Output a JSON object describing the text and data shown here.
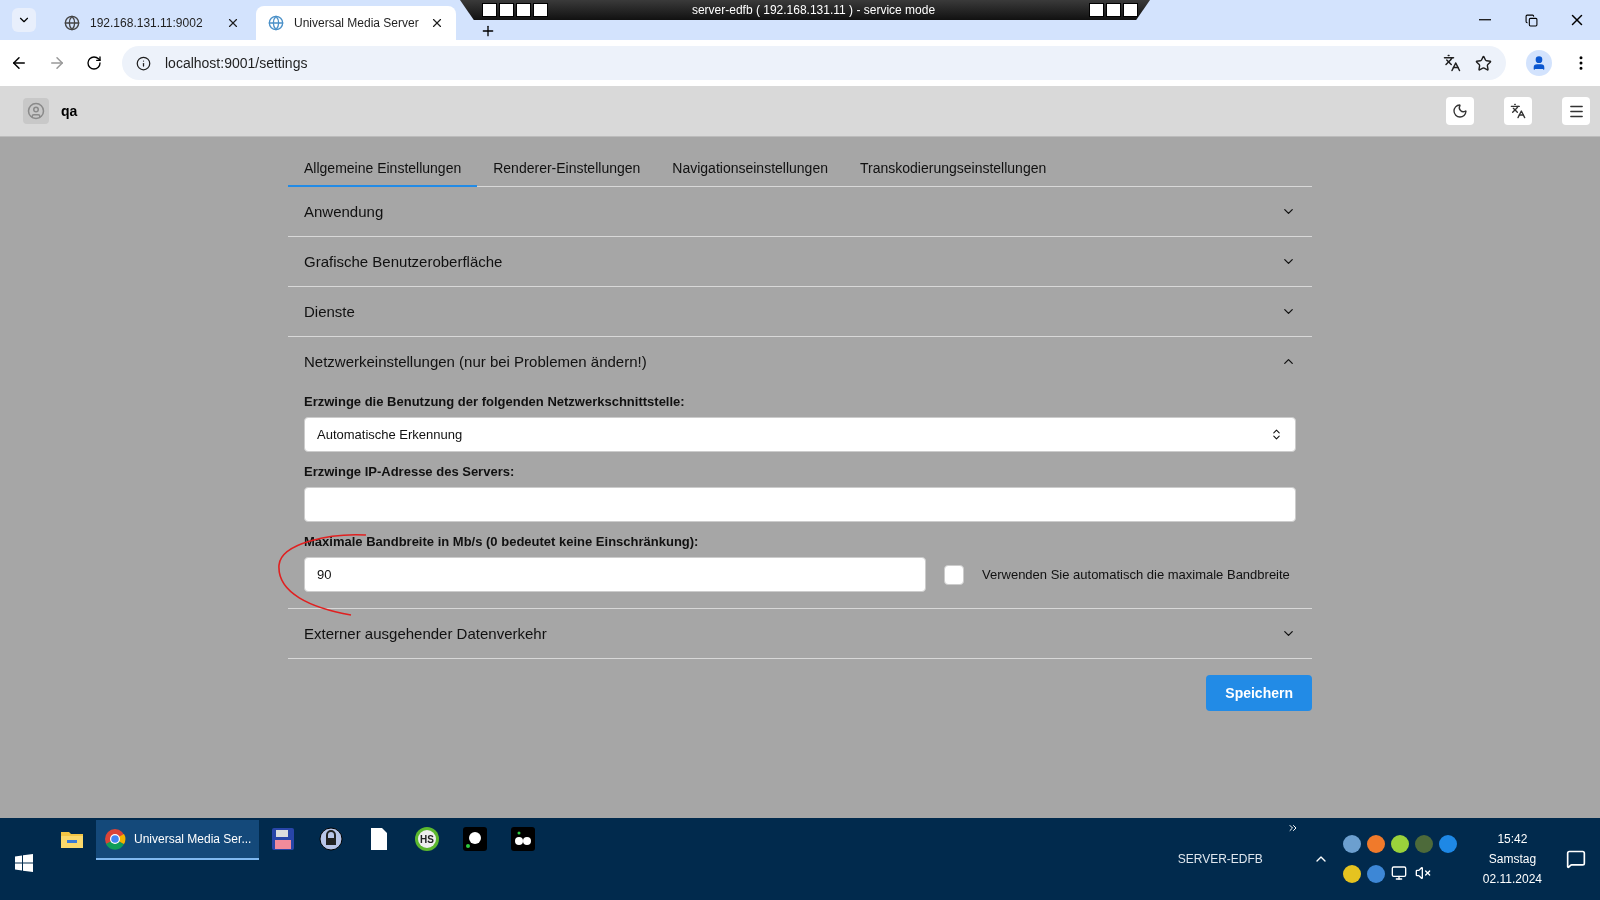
{
  "browser": {
    "tabs": [
      {
        "title": "192.168.131.11:9002",
        "selected": false
      },
      {
        "title": "Universal Media Server",
        "selected": true
      }
    ],
    "url": "localhost:9001/settings"
  },
  "remote_bar": {
    "title": "server-edfb ( 192.168.131.11 ) - service mode"
  },
  "app": {
    "user": "qa"
  },
  "settings_tabs": [
    {
      "label": "Allgemeine Einstellungen",
      "selected": true
    },
    {
      "label": "Renderer-Einstellungen",
      "selected": false
    },
    {
      "label": "Navigationseinstellungen",
      "selected": false
    },
    {
      "label": "Transkodierungseinstellungen",
      "selected": false
    }
  ],
  "sections": [
    {
      "title": "Anwendung",
      "expanded": false
    },
    {
      "title": "Grafische Benutzeroberfläche",
      "expanded": false
    },
    {
      "title": "Dienste",
      "expanded": false
    },
    {
      "title": "Netzwerkeinstellungen (nur bei Problemen ändern!)",
      "expanded": true,
      "fields": [
        {
          "kind": "select",
          "label": "Erzwinge die Benutzung der folgenden Netzwerkschnittstelle:",
          "value": "Automatische Erkennung"
        },
        {
          "kind": "text",
          "label": "Erzwinge IP-Adresse des Servers:"
        },
        {
          "kind": "number",
          "label": "Maximale Bandbreite in Mb/s (0 bedeutet keine Einschränkung):",
          "value": "90",
          "checkbox": {
            "label": "Verwenden Sie automatisch die maximale Bandbreite",
            "checked": false
          }
        }
      ]
    },
    {
      "title": "Externer ausgehender Datenverkehr",
      "expanded": false
    }
  ],
  "save_button": "Speichern",
  "taskbar": {
    "apps": [
      {
        "kind": "folder",
        "selected": false
      },
      {
        "kind": "chrome",
        "label": "Universal Media Ser...",
        "selected": true
      },
      {
        "kind": "floppy",
        "selected": false
      },
      {
        "kind": "lock",
        "selected": false
      },
      {
        "kind": "file",
        "selected": false
      },
      {
        "kind": "badge",
        "glyph": "HS",
        "selected": false
      },
      {
        "kind": "dot",
        "selected": false
      },
      {
        "kind": "pair",
        "selected": false
      }
    ],
    "computer": "SERVER-EDFB",
    "time": "15:42",
    "day": "Samstag",
    "date": "02.11.2024"
  }
}
